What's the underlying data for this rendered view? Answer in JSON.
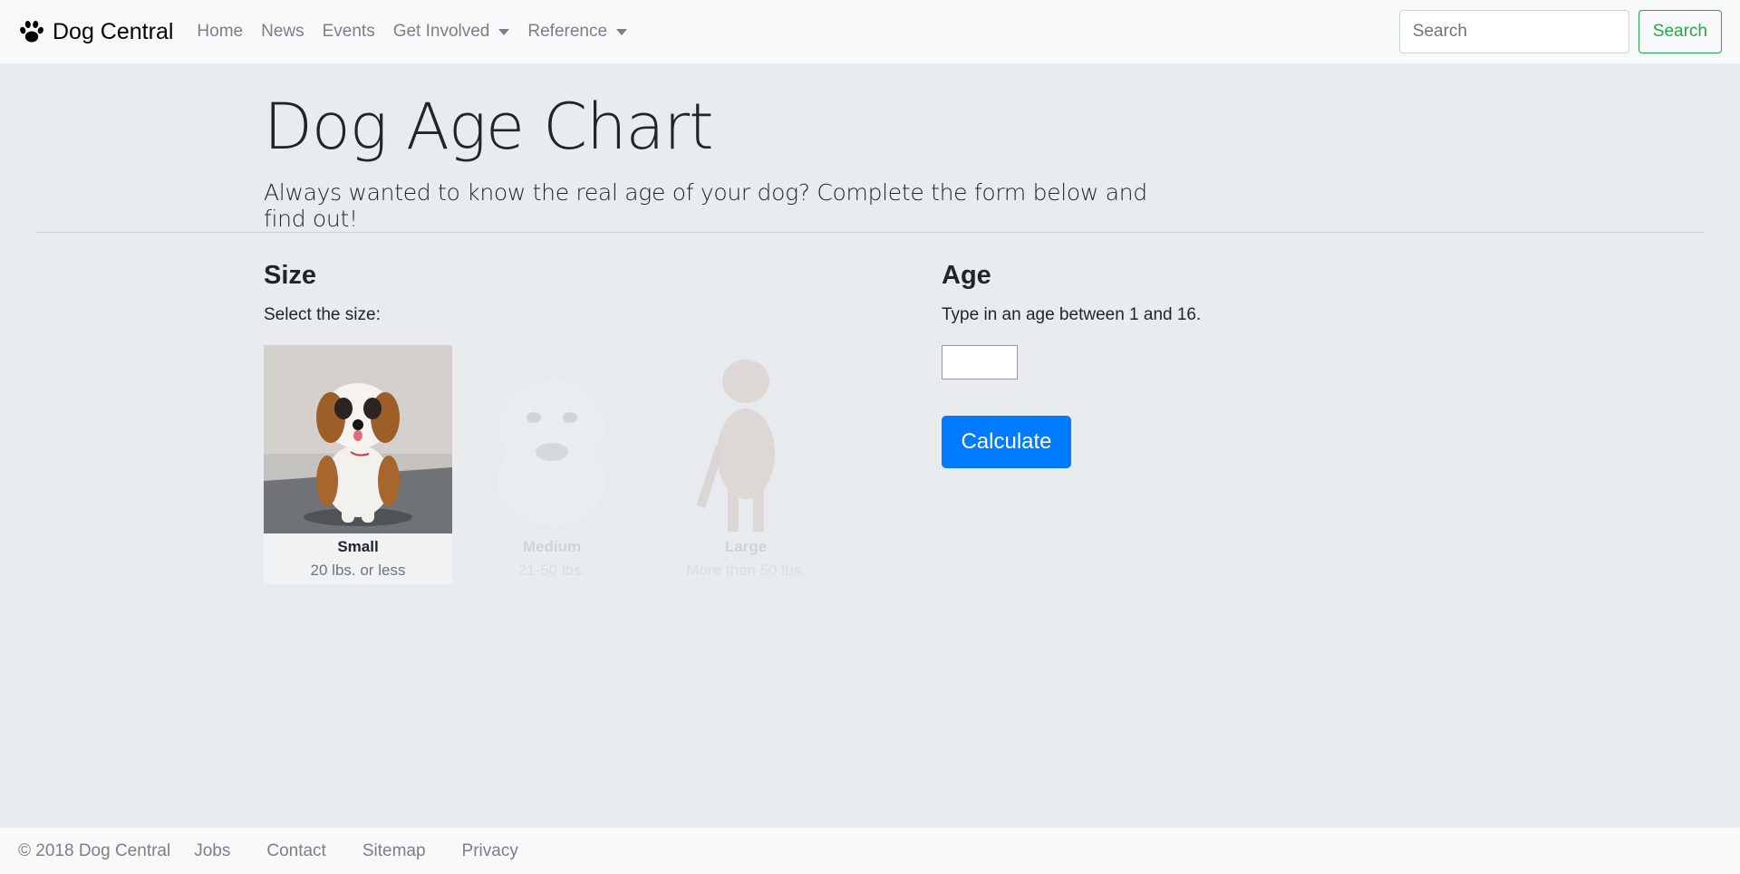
{
  "navbar": {
    "brand": "Dog Central",
    "brand_icon": "paw-icon",
    "links": [
      {
        "label": "Home"
      },
      {
        "label": "News"
      },
      {
        "label": "Events"
      },
      {
        "label": "Get Involved",
        "dropdown": true
      },
      {
        "label": "Reference",
        "dropdown": true
      }
    ],
    "search_placeholder": "Search",
    "search_button": "Search"
  },
  "hero": {
    "title": "Dog Age Chart",
    "subtitle": "Always wanted to know the real age of your dog? Complete the form below and find out!"
  },
  "size": {
    "heading": "Size",
    "description": "Select the size:",
    "options": [
      {
        "name": "Small",
        "weight": "20 lbs. or less",
        "selected": true
      },
      {
        "name": "Medium",
        "weight": "21-50 lbs.",
        "selected": false
      },
      {
        "name": "Large",
        "weight": "More than 50 lbs.",
        "selected": false
      }
    ]
  },
  "age": {
    "heading": "Age",
    "description": "Type in an age between 1 and 16.",
    "value": "",
    "calculate_button": "Calculate"
  },
  "footer": {
    "copyright": "© 2018 Dog Central",
    "links": [
      "Jobs",
      "Contact",
      "Sitemap",
      "Privacy"
    ]
  },
  "colors": {
    "primary": "#007bff",
    "success": "#28a745",
    "background": "#e9ecef",
    "navbar": "#f8f9fa"
  }
}
